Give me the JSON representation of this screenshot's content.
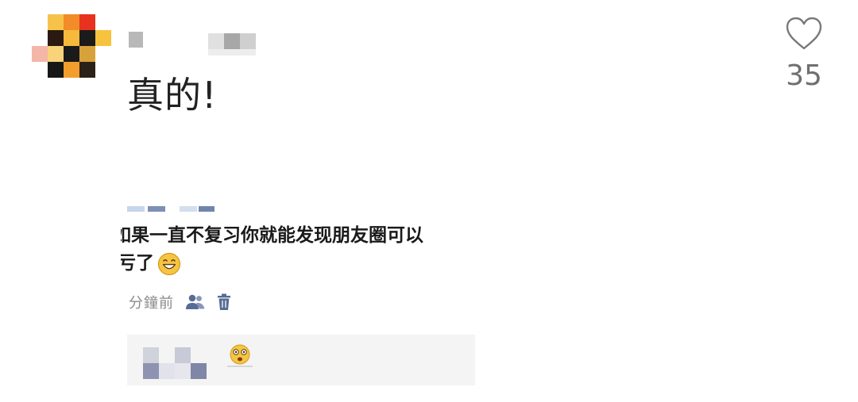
{
  "comment": {
    "text": "真的!",
    "like_count": "35"
  },
  "icons": {
    "like": "heart-outline-icon",
    "friend_visibility": "people-icon",
    "delete": "trash-icon",
    "emoji_grin": "grinning-face-emoji",
    "emoji_shock": "shocked-face-emoji"
  },
  "embedded_post": {
    "line1": "如果一直不复习你就能发现朋友圈可以",
    "line2": "亏了",
    "timestamp": "分鐘前"
  },
  "colors": {
    "text_primary": "#222222",
    "meta_gray": "#8a8a8a",
    "like_gray": "#6f6f6f",
    "link_blue": "#576b95",
    "reply_bg": "#f4f4f4"
  }
}
